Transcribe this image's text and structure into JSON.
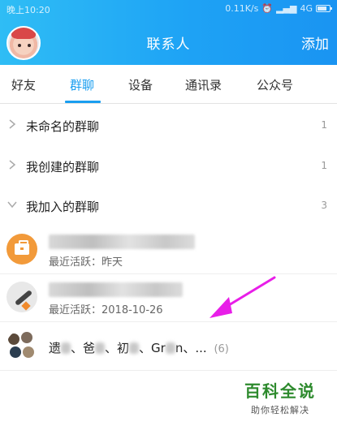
{
  "status_bar": {
    "time": "晚上10:20",
    "network_speed": "0.11K/s",
    "network_type": "4G",
    "battery_level": 0.8
  },
  "header": {
    "title": "联系人",
    "add_label": "添加"
  },
  "tabs": [
    {
      "label": "好友",
      "active": false
    },
    {
      "label": "群聊",
      "active": true
    },
    {
      "label": "设备",
      "active": false
    },
    {
      "label": "通讯录",
      "active": false
    },
    {
      "label": "公众号",
      "active": false
    }
  ],
  "sections": [
    {
      "label": "未命名的群聊",
      "count": "1",
      "expanded": false
    },
    {
      "label": "我创建的群聊",
      "count": "1",
      "expanded": false
    },
    {
      "label": "我加入的群聊",
      "count": "3",
      "expanded": true
    }
  ],
  "groups": [
    {
      "activity": "最近活跃：昨天",
      "icon": "briefcase-icon"
    },
    {
      "activity": "最近活跃：2018-10-26",
      "icon": "pen-icon"
    },
    {
      "names": [
        "遗",
        "、爸",
        "、初",
        "、Gr",
        "n",
        "、..."
      ],
      "member_count": "(6)",
      "icon": "group-avatar-icon"
    }
  ],
  "watermark": {
    "title": "百科全说",
    "subtitle": "助你轻松解决"
  },
  "colors": {
    "accent": "#1a9ef0",
    "header_start": "#2fbdf5",
    "header_end": "#1a94f2",
    "annotation_arrow": "#e81ee8",
    "watermark_green": "#2d8a2d"
  }
}
